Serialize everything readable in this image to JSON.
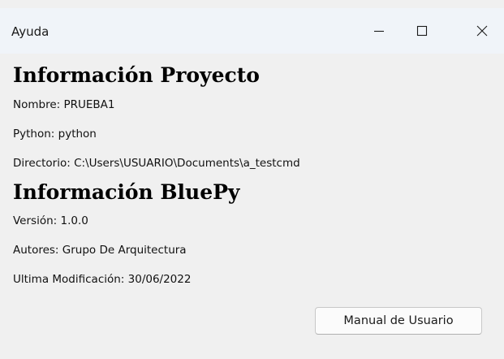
{
  "window": {
    "title": "Ayuda",
    "controls": {
      "minimize": "minimize-icon",
      "maximize": "maximize-icon",
      "close": "close-icon"
    }
  },
  "project_info": {
    "heading": "Información Proyecto",
    "name": "Nombre: PRUEBA1",
    "python": "Python: python",
    "directory": "Directorio: C:\\Users\\USUARIO\\Documents\\a_testcmd"
  },
  "bluepy_info": {
    "heading": "Información BluePy",
    "version": "Versión: 1.0.0",
    "authors": "Autores: Grupo De Arquitectura",
    "last_modified": "Ultima Modificación: 30/06/2022"
  },
  "actions": {
    "manual_label": "Manual de Usuario"
  },
  "colors": {
    "window_background": "#f0f0f0",
    "titlebar_background": "#f0f4f9",
    "button_background": "#fbfbfb"
  }
}
